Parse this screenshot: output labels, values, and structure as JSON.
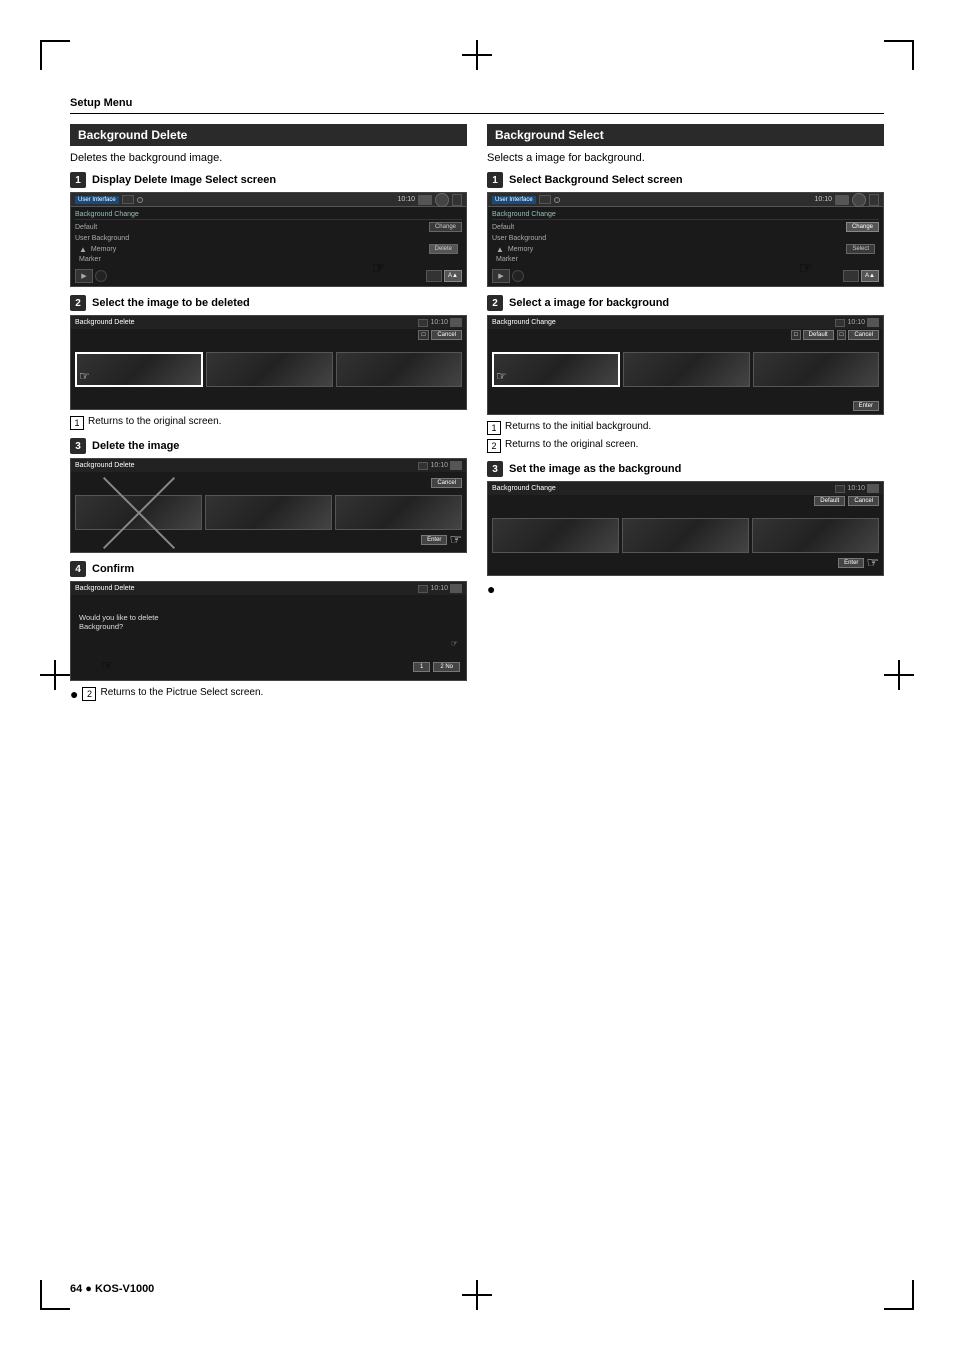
{
  "page": {
    "title": "Setup Menu",
    "footer": "64 ● KOS-V1000"
  },
  "left_section": {
    "header": "Background Delete",
    "description": "Deletes the background image.",
    "steps": [
      {
        "number": "1",
        "label": "Display Delete Image Select screen",
        "screen": {
          "title": "User Interface",
          "subtitle": "Background Change",
          "time": "10:10"
        }
      },
      {
        "number": "2",
        "label": "Select the image to be deleted",
        "screen": {
          "title": "Background Delete",
          "time": "10:10"
        },
        "cancel_btn": "Cancel"
      },
      {
        "number": "3",
        "label": "Delete the image",
        "screen": {
          "title": "Background Delete",
          "time": "10:10"
        },
        "enter_btn": "Enter"
      },
      {
        "number": "4",
        "label": "Confirm",
        "screen": {
          "title": "Background Delete",
          "time": "10:10"
        },
        "confirm_text": "Would you like to delete Background?",
        "yes_btn": "1",
        "no_btn": "2  No"
      }
    ],
    "note": {
      "num": "2",
      "text": "Returns to the Pictrue Select screen."
    },
    "note1": {
      "num": "1",
      "text": "Returns to the original screen."
    }
  },
  "right_section": {
    "header": "Background Select",
    "description": "Selects a image for background.",
    "steps": [
      {
        "number": "1",
        "label": "Select Background Select screen",
        "screen": {
          "title": "User Interface",
          "subtitle": "Background Change",
          "time": "10:10"
        }
      },
      {
        "number": "2",
        "label": "Select a image for background",
        "screen": {
          "title": "Background Change",
          "time": "10:10"
        },
        "enter_btn": "Enter",
        "default_btn": "Default",
        "cancel_btn": "Cancel"
      },
      {
        "number": "3",
        "label": "Set the image as the background",
        "screen": {
          "title": "Background Change",
          "time": "10:10"
        },
        "enter_btn": "Enter",
        "default_btn": "Default",
        "cancel_btn": "Cancel"
      }
    ],
    "notes": [
      {
        "num": "1",
        "text": "Returns to the initial background."
      },
      {
        "num": "2",
        "text": "Returns to the original screen."
      }
    ]
  }
}
